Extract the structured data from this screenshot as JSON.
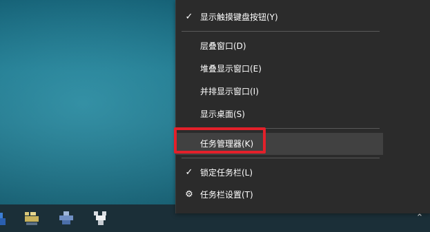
{
  "context_menu": {
    "items": [
      {
        "label": "显示触摸键盘按钮(Y)",
        "icon": "check-icon"
      },
      {
        "label": "层叠窗口(D)"
      },
      {
        "label": "堆叠显示窗口(E)"
      },
      {
        "label": "并排显示窗口(I)"
      },
      {
        "label": "显示桌面(S)"
      },
      {
        "label": "任务管理器(K)",
        "highlighted": true,
        "highlight_color": "#e3202a"
      },
      {
        "label": "锁定任务栏(L)",
        "icon": "check-icon"
      },
      {
        "label": "任务栏设置(T)",
        "icon": "gear-icon"
      }
    ],
    "background": "#2b2b2b",
    "hover_background": "#414141"
  },
  "glyphs": {
    "check": "✓",
    "gear": "⚙"
  },
  "taskbar": {
    "background": "#1b2f38",
    "icons": [
      "app-icon",
      "app-icon",
      "app-icon",
      "app-icon"
    ],
    "tray_chevron": "⌃"
  }
}
